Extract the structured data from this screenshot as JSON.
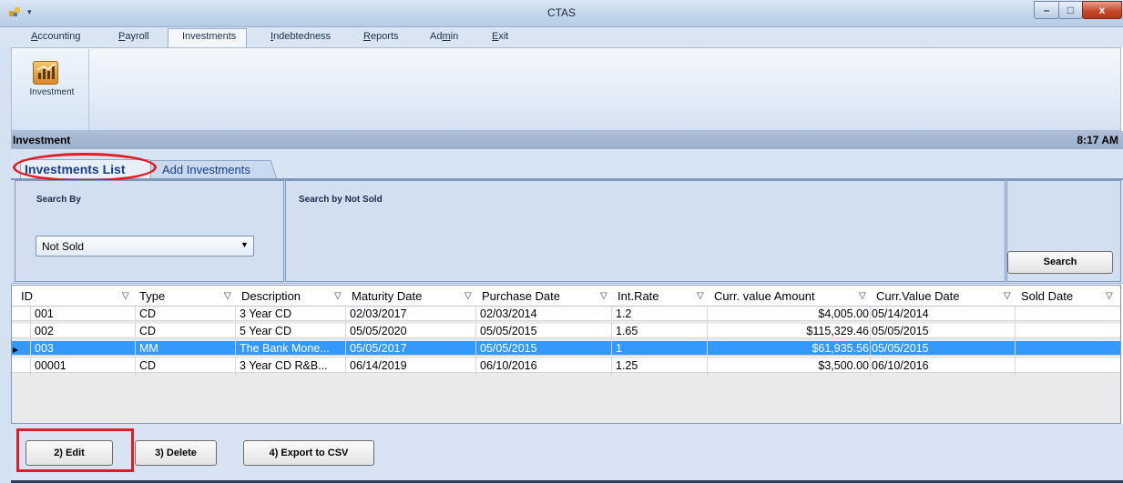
{
  "window": {
    "title": "CTAS",
    "min": "–",
    "max": "□",
    "close": "x"
  },
  "menu": [
    {
      "label": "Accounting",
      "underline": "A"
    },
    {
      "label": "Payroll",
      "underline": "P"
    },
    {
      "label": "Investments",
      "underline": ""
    },
    {
      "label": "Indebtedness",
      "underline": "I"
    },
    {
      "label": "Reports",
      "underline": "R"
    },
    {
      "label": "Admin",
      "underline": "m"
    },
    {
      "label": "Exit",
      "underline": "E"
    }
  ],
  "ribbon": {
    "investment_label": "Investment"
  },
  "header": {
    "title": "Investment",
    "time": "8:17 AM"
  },
  "tabs": {
    "list": "Investments List",
    "add": "Add Investments"
  },
  "search": {
    "search_by_label": "Search By",
    "search_not_sold_label": "Search by Not Sold",
    "selected": "Not Sold",
    "button": "Search"
  },
  "grid": {
    "columns": [
      "ID",
      "Type",
      "Description",
      "Maturity Date",
      "Purchase Date",
      "Int.Rate",
      "Curr. value Amount",
      "Curr.Value Date",
      "Sold Date"
    ],
    "rows": [
      {
        "id": "001",
        "type": "CD",
        "desc": "3 Year CD",
        "maturity": "02/03/2017",
        "purchase": "02/03/2014",
        "rate": "1.2",
        "amount": "$4,005.00",
        "value_date": "05/14/2014",
        "sold": ""
      },
      {
        "id": "002",
        "type": "CD",
        "desc": "5 Year CD",
        "maturity": "05/05/2020",
        "purchase": "05/05/2015",
        "rate": "1.65",
        "amount": "$115,329.46",
        "value_date": "05/05/2015",
        "sold": ""
      },
      {
        "id": "003",
        "type": "MM",
        "desc": "The Bank Mone...",
        "maturity": "05/05/2017",
        "purchase": "05/05/2015",
        "rate": "1",
        "amount": "$61,935.56",
        "value_date": "05/05/2015",
        "sold": ""
      },
      {
        "id": "00001",
        "type": "CD",
        "desc": "3 Year CD R&B...",
        "maturity": "06/14/2019",
        "purchase": "06/10/2016",
        "rate": "1.25",
        "amount": "$3,500.00",
        "value_date": "06/10/2016",
        "sold": ""
      }
    ]
  },
  "buttons": {
    "edit": "2) Edit",
    "delete": "3) Delete",
    "export": "4) Export to CSV"
  },
  "colors": {
    "highlight": "#e31b23",
    "selection": "#3399ff"
  }
}
